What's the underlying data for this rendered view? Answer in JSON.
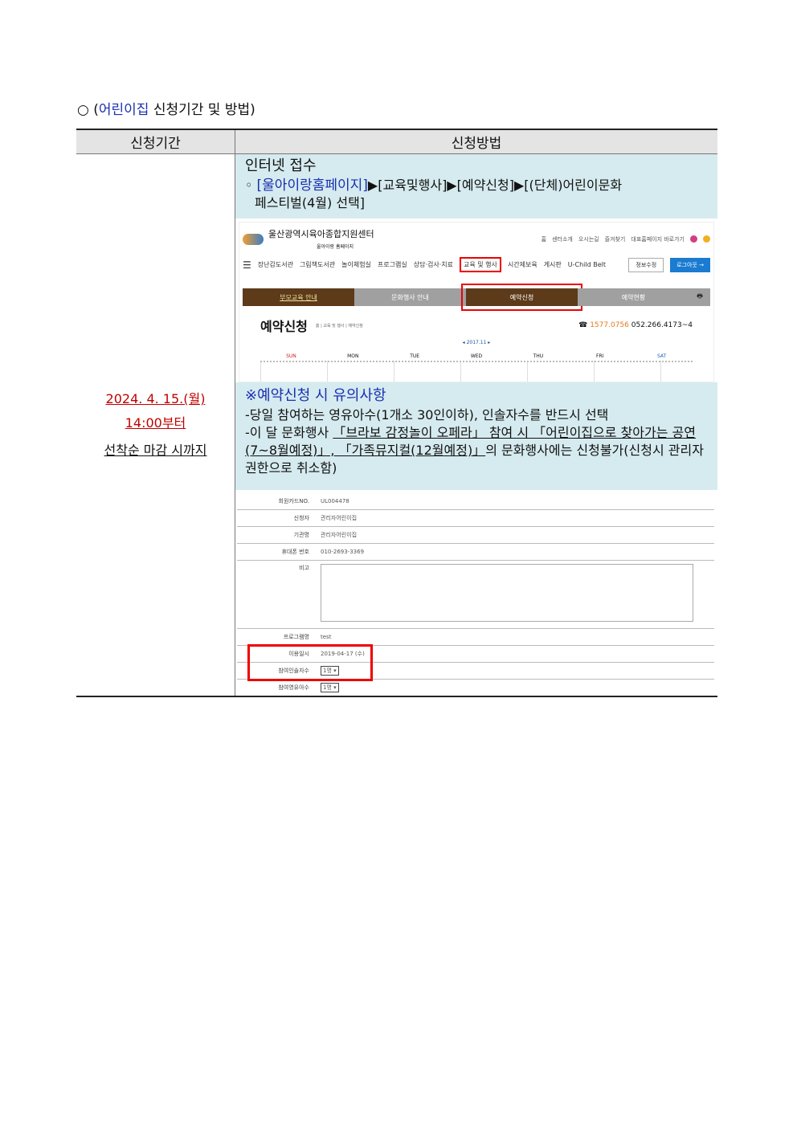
{
  "heading": {
    "prefix": "○ (",
    "highlight": "어린이집",
    "suffix": " 신청기간 및 방법)"
  },
  "table": {
    "col1": "신청기간",
    "col2": "신청방법",
    "period": {
      "date": "2024. 4. 15.(월)",
      "time": "14:00부터",
      "note": "선착순 마감 시까지"
    },
    "internet": {
      "title": "인터넷 접수",
      "bullet": "◦",
      "path_link": "[울아이랑홈페이지]",
      "path_rest": "▶[교육및행사]▶[예약신청]▶[(단체)어린이문화",
      "path_rest2": "페스티벌(4월) 선택]"
    },
    "caution": {
      "title": "※예약신청 시 유의사항",
      "line1": "-당일 참여하는 영유아수(1개소 30인이하), 인솔자수를 반드시 선택",
      "line2a": "-이 달 문화행사 ",
      "line2b": "「브라보 감정놀이 오페라」 참여 시 「어린이집으로 찾아가는 공연(7~8월예정)」, 「가족뮤지컬(12월예정)」",
      "line2c": "의 문화행사에는 신청불가(신청시 관리자 권한으로 취소함)"
    }
  },
  "screenshot": {
    "site_name": "울산광역시육아종합지원센터",
    "site_sub": "울아이랑 홈페이지",
    "toplinks": [
      "홈",
      "센터소개",
      "오시는길",
      "즐겨찾기",
      "대표홈페이지 바로가기"
    ],
    "nav": [
      "장난감도서관",
      "그림책도서관",
      "놀이체험실",
      "프로그램실",
      "상담·검사·치료",
      "교육 및 행사",
      "시간제보육",
      "게시판",
      "U-Child Belt"
    ],
    "btn_info": "정보수정",
    "btn_logout": "로그아웃 →",
    "tabs": [
      "부모교육 안내",
      "문화행사 안내",
      "예약신청",
      "예약현황"
    ],
    "print_icon": "🖶",
    "resv_title": "예약신청",
    "crumb": "홈 | 교육 및 행사 | 예약신청",
    "phone_icon": "☎",
    "phone1": "1577.0756",
    "phone2": "052.266.4173~4",
    "month": "◂ 2017.11 ▸",
    "days": [
      "SUN",
      "MON",
      "TUE",
      "WED",
      "THU",
      "FRI",
      "SAT"
    ],
    "form": [
      {
        "label": "회원카드NO.",
        "value": "UL004478"
      },
      {
        "label": "신청자",
        "value": "관리자어린이집"
      },
      {
        "label": "기관명",
        "value": "관리자어린이집"
      },
      {
        "label": "휴대폰 번호",
        "value": "010-2693-3369"
      },
      {
        "label": "비고",
        "value": ""
      },
      {
        "label": "프로그램명",
        "value": "test"
      },
      {
        "label": "이용일시",
        "value": "2019-04-17 (수)"
      },
      {
        "label": "참여인솔자수",
        "value": "1명 ▾"
      },
      {
        "label": "참여영유아수",
        "value": "1명 ▾"
      }
    ]
  }
}
